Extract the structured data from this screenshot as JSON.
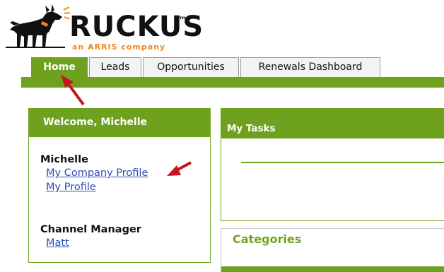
{
  "logo": {
    "brand": "RUCKUS",
    "trademark": "™",
    "subtitle": "an ARRIS company"
  },
  "tabs": [
    {
      "label": "Home",
      "active": true
    },
    {
      "label": "Leads",
      "active": false
    },
    {
      "label": "Opportunities",
      "active": false
    },
    {
      "label": "Renewals Dashboard",
      "active": false
    }
  ],
  "welcome_panel": {
    "title": "Welcome, Michelle",
    "name": "Michelle",
    "links": [
      "My Company Profile",
      "My Profile"
    ],
    "channel_manager_label": "Channel Manager",
    "channel_manager_name": "Matt"
  },
  "tasks_panel": {
    "title": "My Tasks"
  },
  "categories_panel": {
    "title": "Categories"
  },
  "colors": {
    "accent": "#6ea21e",
    "annotation": "#c8141e",
    "link": "#2a4fb4",
    "logo_orange": "#f08a1c"
  }
}
